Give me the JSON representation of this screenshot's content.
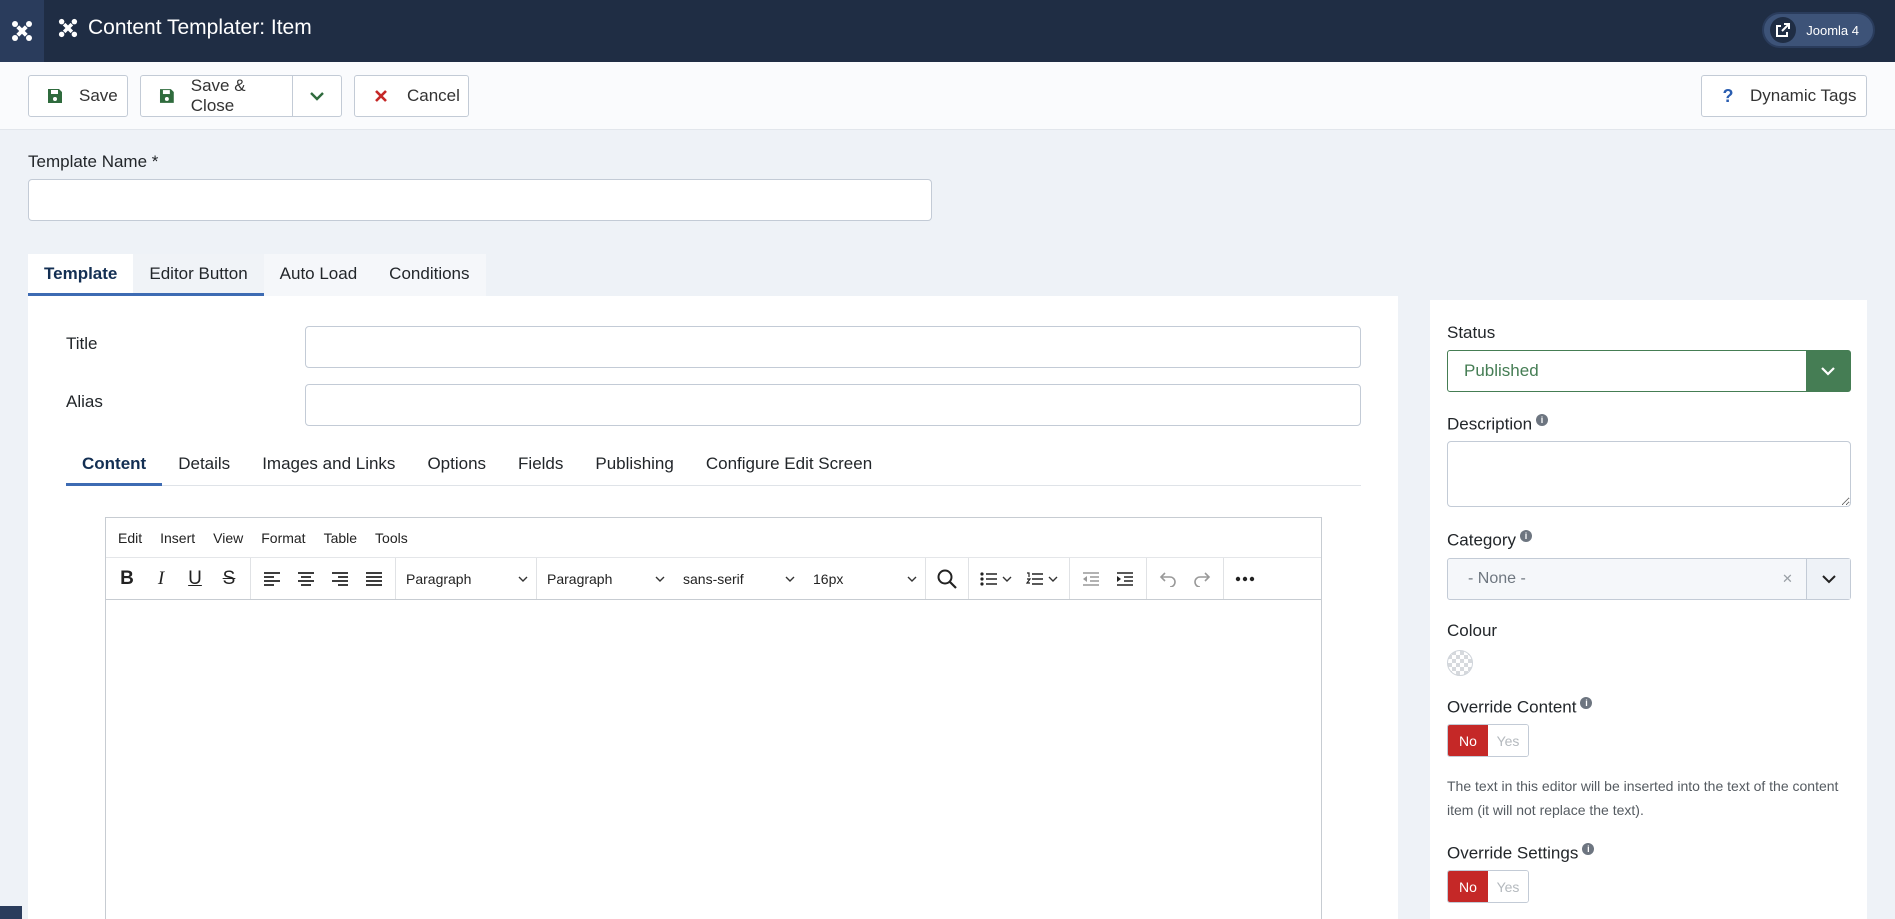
{
  "header": {
    "title": "Content Templater: Item",
    "badge_label": "Joomla 4"
  },
  "toolbar": {
    "save_label": "Save",
    "save_close_label": "Save & Close",
    "cancel_label": "Cancel",
    "dynamic_tags_label": "Dynamic Tags"
  },
  "form": {
    "template_name_label": "Template Name *",
    "template_name_value": ""
  },
  "main_tabs": [
    {
      "label": "Template"
    },
    {
      "label": "Editor Button"
    },
    {
      "label": "Auto Load"
    },
    {
      "label": "Conditions"
    }
  ],
  "fields": {
    "title_label": "Title",
    "title_value": "",
    "alias_label": "Alias",
    "alias_value": ""
  },
  "sub_tabs": [
    {
      "label": "Content"
    },
    {
      "label": "Details"
    },
    {
      "label": "Images and Links"
    },
    {
      "label": "Options"
    },
    {
      "label": "Fields"
    },
    {
      "label": "Publishing"
    },
    {
      "label": "Configure Edit Screen"
    }
  ],
  "editor": {
    "menu": [
      "Edit",
      "Insert",
      "View",
      "Format",
      "Table",
      "Tools"
    ],
    "block_format": "Paragraph",
    "style_format": "Paragraph",
    "font_family": "sans-serif",
    "font_size": "16px"
  },
  "sidebar": {
    "status_label": "Status",
    "status_value": "Published",
    "description_label": "Description",
    "category_label": "Category",
    "category_value": "- None -",
    "colour_label": "Colour",
    "override_content_label": "Override Content",
    "override_content_no": "No",
    "override_content_yes": "Yes",
    "override_help": "The text in this editor will be inserted into the text of the content item (it will not replace the text).",
    "override_settings_label": "Override Settings",
    "override_settings_no": "No",
    "override_settings_yes": "Yes",
    "info_glyph": "i"
  },
  "colors": {
    "header_bg": "#1f2d44",
    "accent_blue": "#3d6bb3",
    "published_green": "#457d54",
    "toggle_red": "#c52827",
    "cancel_red": "#c52827"
  }
}
